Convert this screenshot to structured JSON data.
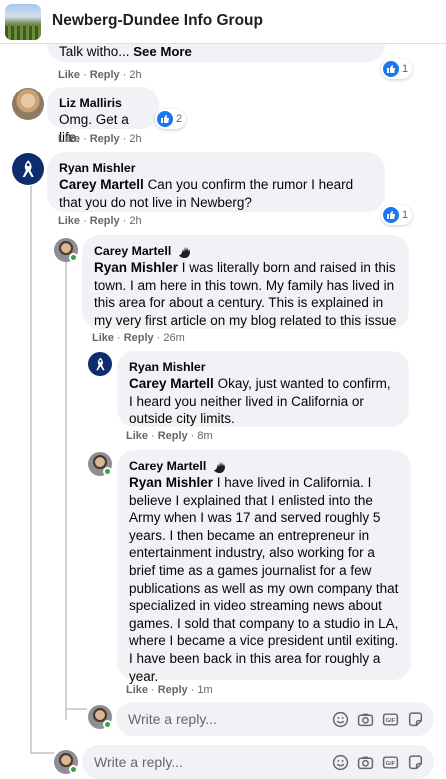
{
  "header": {
    "title": "Newberg-Dundee Info Group"
  },
  "comments": [
    {
      "text_prefix": "Talk witho...",
      "see_more": "See More",
      "actions": {
        "like": "Like",
        "reply": "Reply",
        "time": "2h"
      },
      "reactions": "1"
    },
    {
      "author": "Liz Malliris",
      "text": "Omg. Get a life.",
      "actions": {
        "like": "Like",
        "reply": "Reply",
        "time": "2h"
      },
      "reactions": "2"
    },
    {
      "author": "Ryan Mishler",
      "mention": "Carey Martell",
      "text": "Can you confirm the rumor I heard that you do not live in Newberg?",
      "actions": {
        "like": "Like",
        "reply": "Reply",
        "time": "2h"
      },
      "reactions": "1"
    },
    {
      "author": "Carey Martell",
      "mention": "Ryan Mishler",
      "text": "I was literally born and raised in this town. I am here in this town. My family has lived in this area for about a century. This is explained in my very first article on my blog related to this issue",
      "actions": {
        "like": "Like",
        "reply": "Reply",
        "time": "26m"
      }
    },
    {
      "author": "Ryan Mishler",
      "mention": "Carey Martell",
      "text": "Okay, just wanted to confirm, I heard you neither lived in California or outside city limits.",
      "actions": {
        "like": "Like",
        "reply": "Reply",
        "time": "8m"
      }
    },
    {
      "author": "Carey Martell",
      "mention": "Ryan Mishler",
      "text": "I have lived in California. I believe I explained that I enlisted into the Army when I was 17 and served roughly 5 years. I then became an entrepreneur in entertainment industry, also working for a brief time as a games journalist for a few publications as well as my own company that specialized in video streaming news about games. I sold that company to a studio in LA, where I became a vice president until exiting. I have been back in this area for roughly a year.",
      "actions": {
        "like": "Like",
        "reply": "Reply",
        "time": "1m"
      }
    }
  ],
  "reply_boxes": [
    {
      "placeholder": "Write a reply..."
    },
    {
      "placeholder": "Write a reply..."
    }
  ],
  "colors": {
    "bubble": "#f0f2f5",
    "like_blue": "#1877f2",
    "online_green": "#31a24c",
    "meta_gray": "#65676b"
  }
}
